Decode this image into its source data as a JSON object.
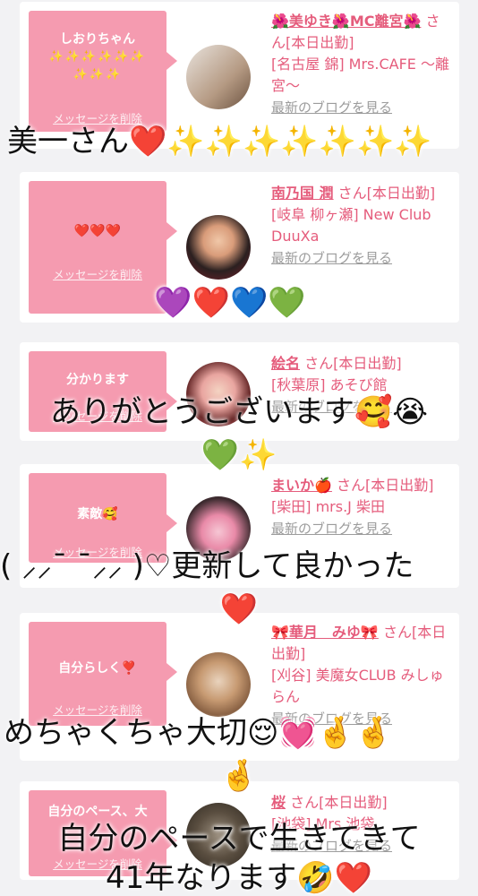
{
  "cards": [
    {
      "bubble_title": "しおりちゃん",
      "bubble_extra": "✨✨✨✨✨✨ ✨✨✨",
      "delete_link": "メッセージを削除",
      "name": "🌺美ゆき🌺MC離宮🌺",
      "suffix": "さん[本日出勤]",
      "shop": "[名古屋 錦] Mrs.CAFE 〜離宮〜",
      "blog": "最新のブログを見る"
    },
    {
      "bubble_title": "❤️❤️❤️",
      "delete_link": "メッセージを削除",
      "name": "南乃国 潤",
      "suffix": "さん[本日出勤]",
      "shop": "[岐阜 柳ヶ瀬] New Club DuuXa",
      "blog": "最新のブログを見る"
    },
    {
      "bubble_title": "分かります",
      "delete_link": "メッセージを削除",
      "name": "絵名",
      "suffix": "さん[本日出勤]",
      "shop": "[秋葉原] あそび館",
      "blog": "最新のブログを見る"
    },
    {
      "bubble_title": "素敵🥰",
      "delete_link": "メッセージを削除",
      "name": "まいか🍎",
      "suffix": "さん[本日出勤]",
      "shop": "[柴田] mrs.J 柴田",
      "blog": "最新のブログを見る"
    },
    {
      "bubble_title": "自分らしく❣️",
      "delete_link": "メッセージを削除",
      "name": "🎀華月　みゆ🎀",
      "suffix": "さん[本日出勤]",
      "shop": "[刈谷] 美魔女CLUB みしゅらん",
      "blog": "最新のブログを見る"
    },
    {
      "bubble_title": "自分のペース、大",
      "delete_link": "メッセージを削除",
      "name": "桜",
      "suffix": "さん[本日出勤]",
      "shop": "[池袋] Mrs 池袋",
      "blog": "最新のブログを見る"
    }
  ],
  "overlays": {
    "o1": "美一さん❤️✨✨✨✨✨✨✨",
    "o2": "💜❤️💙💚",
    "o3": "ありがとうございます🥰😭",
    "o4": "💚✨",
    "o5": "( ⸝⸝¯ ¯⸝⸝ )♡更新して良かった",
    "o6": "❤️",
    "o7": "めちゃくちゃ大切😌💓🤞🤞",
    "o8": "🤞",
    "o9": "自分のペースで生きてきて",
    "o10": "41年なります🤣❤️"
  },
  "colors": {
    "bubble": "#f59bb0",
    "link": "#e55c7c",
    "muted": "#9c9c9c",
    "background": "#f2f2f4"
  }
}
